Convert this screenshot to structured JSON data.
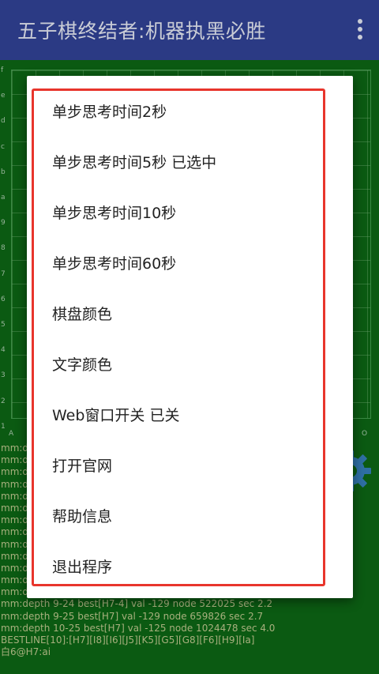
{
  "app": {
    "title": "五子棋终结者:机器执黑必胜"
  },
  "board": {
    "row_labels": [
      "f",
      "e",
      "d",
      "c",
      "b",
      "a",
      "9",
      "8",
      "7",
      "6",
      "5",
      "4",
      "3",
      "2",
      "1"
    ],
    "col_labels": [
      "A",
      "O"
    ]
  },
  "log": {
    "hidden_lines": [
      "mm:d",
      "mm:d",
      "mm:d",
      "mm:d",
      "mm:d",
      "mm:d",
      "mm:d",
      "mm:d",
      "mm:d",
      "mm:d",
      "mm:d",
      "mm:d",
      "mm:d"
    ],
    "lines": [
      "mm:depth 9-24 best[H7-4] val -129 node 522025 sec 2.2",
      "mm:depth 9-25 best[H7] val -129 node 659826 sec 2.7",
      "mm:depth 10-25 best[H7] val -125 node 1024478 sec 4.0",
      "BESTLINE[10]:[H7][I8][I6][J5][K5][G5][G8][F6][H9][Ia]",
      "白6@H7:ai"
    ]
  },
  "menu": {
    "items": [
      {
        "label": "单步思考时间2秒"
      },
      {
        "label": "单步思考时间5秒  已选中"
      },
      {
        "label": "单步思考时间10秒"
      },
      {
        "label": "单步思考时间60秒"
      },
      {
        "label": "棋盘颜色"
      },
      {
        "label": "文字颜色"
      },
      {
        "label": "Web窗口开关  已关"
      },
      {
        "label": "打开官网"
      },
      {
        "label": "帮助信息"
      },
      {
        "label": "退出程序"
      }
    ]
  },
  "colors": {
    "appbar": "#2b3a84",
    "board_bg": "#0b5a12",
    "highlight": "#e8352c",
    "log_text": "#a8b07e"
  },
  "icons": {
    "overflow": "more-vert-icon",
    "settings": "gear-icon"
  }
}
